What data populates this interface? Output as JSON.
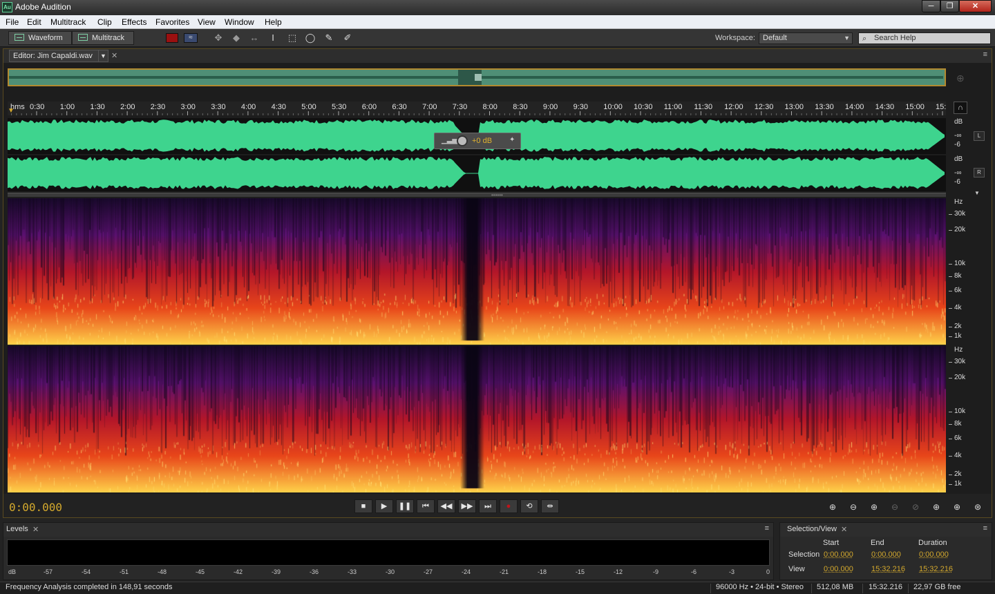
{
  "window": {
    "title": "Adobe Audition",
    "icon_text": "Au",
    "minimize": "─",
    "maximize": "❐",
    "close": "✕"
  },
  "menu": [
    "File",
    "Edit",
    "Multitrack",
    "Clip",
    "Effects",
    "Favorites",
    "View",
    "Window",
    "Help"
  ],
  "toolbar": {
    "waveform_label": "Waveform",
    "multitrack_label": "Multitrack",
    "workspace_label": "Workspace:",
    "workspace_value": "Default",
    "search_placeholder": "Search Help",
    "tools": [
      "move-tool",
      "razor-tool",
      "slip-tool",
      "time-selection-tool",
      "marquee-selection-tool",
      "lasso-selection-tool",
      "brush-selection-tool",
      "spot-healing-brush-tool"
    ]
  },
  "editor": {
    "tab_label": "Editor: Jim Capaldi.wav",
    "ruler_unit": "hms",
    "ruler_ticks": [
      "0:30",
      "1:00",
      "1:30",
      "2:00",
      "2:30",
      "3:00",
      "3:30",
      "4:00",
      "4:30",
      "5:00",
      "5:30",
      "6:00",
      "6:30",
      "7:00",
      "7:30",
      "8:00",
      "8:30",
      "9:00",
      "9:30",
      "10:00",
      "10:30",
      "11:00",
      "11:30",
      "12:00",
      "12:30",
      "13:00",
      "13:30",
      "14:00",
      "14:30",
      "15:00",
      "15:"
    ],
    "channels": [
      {
        "label": "L",
        "db_labels": [
          "dB",
          "-∞",
          "-6"
        ]
      },
      {
        "label": "R",
        "db_labels": [
          "dB",
          "-∞",
          "-6"
        ]
      }
    ],
    "hud_gain": "+0 dB",
    "spectral_axis": [
      "Hz",
      "30k",
      "20k",
      "10k",
      "8k",
      "6k",
      "4k",
      "2k",
      "1k"
    ],
    "time_display": "0:00.000"
  },
  "levels": {
    "tab_label": "Levels",
    "scale": [
      "dB",
      "-57",
      "-54",
      "-51",
      "-48",
      "-45",
      "-42",
      "-39",
      "-36",
      "-33",
      "-30",
      "-27",
      "-24",
      "-21",
      "-18",
      "-15",
      "-12",
      "-9",
      "-6",
      "-3",
      "0"
    ]
  },
  "selection_view": {
    "tab_label": "Selection/View",
    "headers": [
      "Start",
      "End",
      "Duration"
    ],
    "rows": [
      {
        "label": "Selection",
        "start": "0:00.000",
        "end": "0:00.000",
        "duration": "0:00.000"
      },
      {
        "label": "View",
        "start": "0:00.000",
        "end": "15:32.216",
        "duration": "15:32.216"
      }
    ]
  },
  "status": {
    "message": "Frequency Analysis completed in 148,91 seconds",
    "format": "96000 Hz • 24-bit • Stereo",
    "size": "512,08 MB",
    "duration": "15:32.216",
    "free": "22,97 GB free"
  },
  "colors": {
    "waveform": "#3ed48e",
    "accent": "#d4a92d",
    "record": "#c0141a"
  }
}
